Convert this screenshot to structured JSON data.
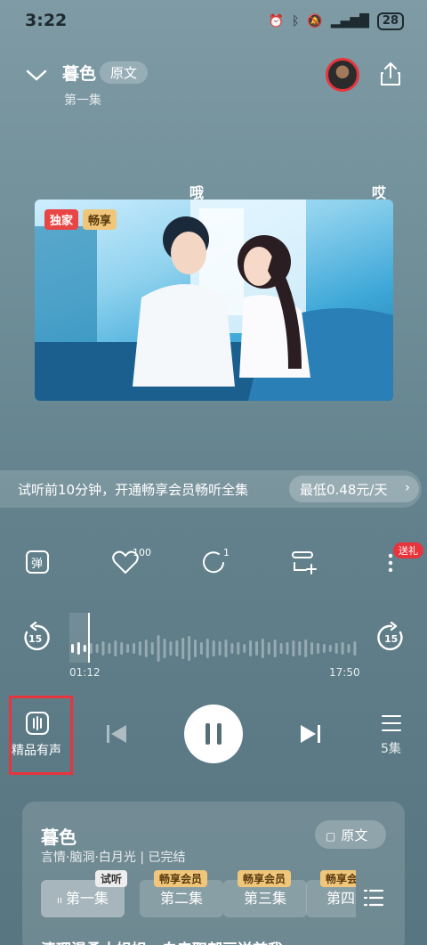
{
  "status_bar": {
    "time": "3:22",
    "battery": "28"
  },
  "header": {
    "title": "暮色",
    "original_tag": "原文",
    "episode": "第一集"
  },
  "danmaku": [
    "哦",
    "哎"
  ],
  "cover": {
    "badges": [
      "独家",
      "畅享"
    ]
  },
  "trial": {
    "text": "试听前10分钟，开通畅享会员畅听全集",
    "price": "最低0.48元/天"
  },
  "actions": {
    "like_count": "100",
    "comment_count": "1",
    "gift_badge": "送礼"
  },
  "player": {
    "skip_back": "15",
    "skip_forward": "15",
    "elapsed": "01:12",
    "duration": "17:50",
    "quality_label": "精品有声",
    "episode_count": "5集"
  },
  "card": {
    "title": "暮色",
    "subtitle": "言情·脑洞·白月光 | 已完结",
    "original_button": "原文",
    "episodes": [
      {
        "label": "第一集",
        "tag": "试听"
      },
      {
        "label": "第二集",
        "tag": "畅享会员"
      },
      {
        "label": "第三集",
        "tag": "畅享会员"
      },
      {
        "label": "第四集",
        "tag": "畅享会"
      }
    ]
  },
  "bottom_text": "清理渴柔大姐姐，白忠职部画送首我"
}
